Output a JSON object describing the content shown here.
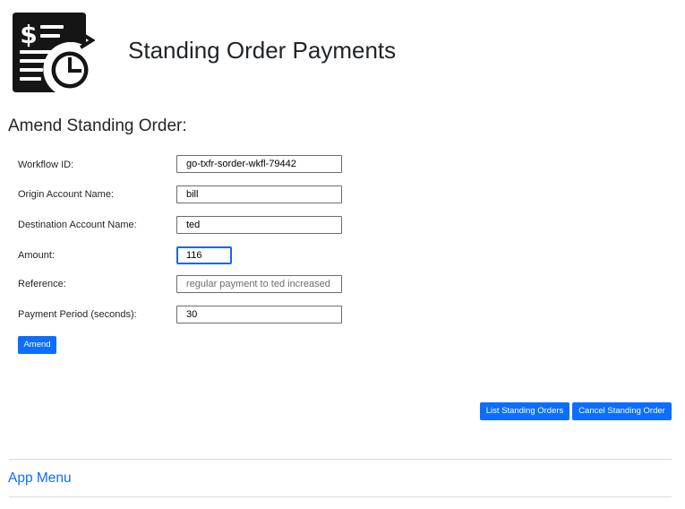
{
  "header": {
    "title": "Standing Order Payments",
    "logo_icon": "standing-order-document-clock-icon"
  },
  "form": {
    "heading": "Amend Standing Order:",
    "fields": {
      "workflow_id": {
        "label": "Workflow ID:",
        "value": "go-txfr-sorder-wkfl-79442"
      },
      "origin_account": {
        "label": "Origin Account Name:",
        "value": "bill"
      },
      "destination_account": {
        "label": "Destination Account Name:",
        "value": "ted"
      },
      "amount": {
        "label": "Amount:",
        "value": "116"
      },
      "reference": {
        "label": "Reference:",
        "value": "",
        "placeholder": "regular payment to ted increased"
      },
      "payment_period": {
        "label": "Payment Period (seconds):",
        "value": "30"
      }
    },
    "submit_label": "Amend"
  },
  "actions": {
    "list_label": "List Standing Orders",
    "cancel_label": "Cancel Standing Order"
  },
  "footer": {
    "menu_label": "App Menu"
  },
  "colors": {
    "primary": "#0d6efd",
    "focus_border": "#1a6ad8",
    "text": "#212529"
  }
}
